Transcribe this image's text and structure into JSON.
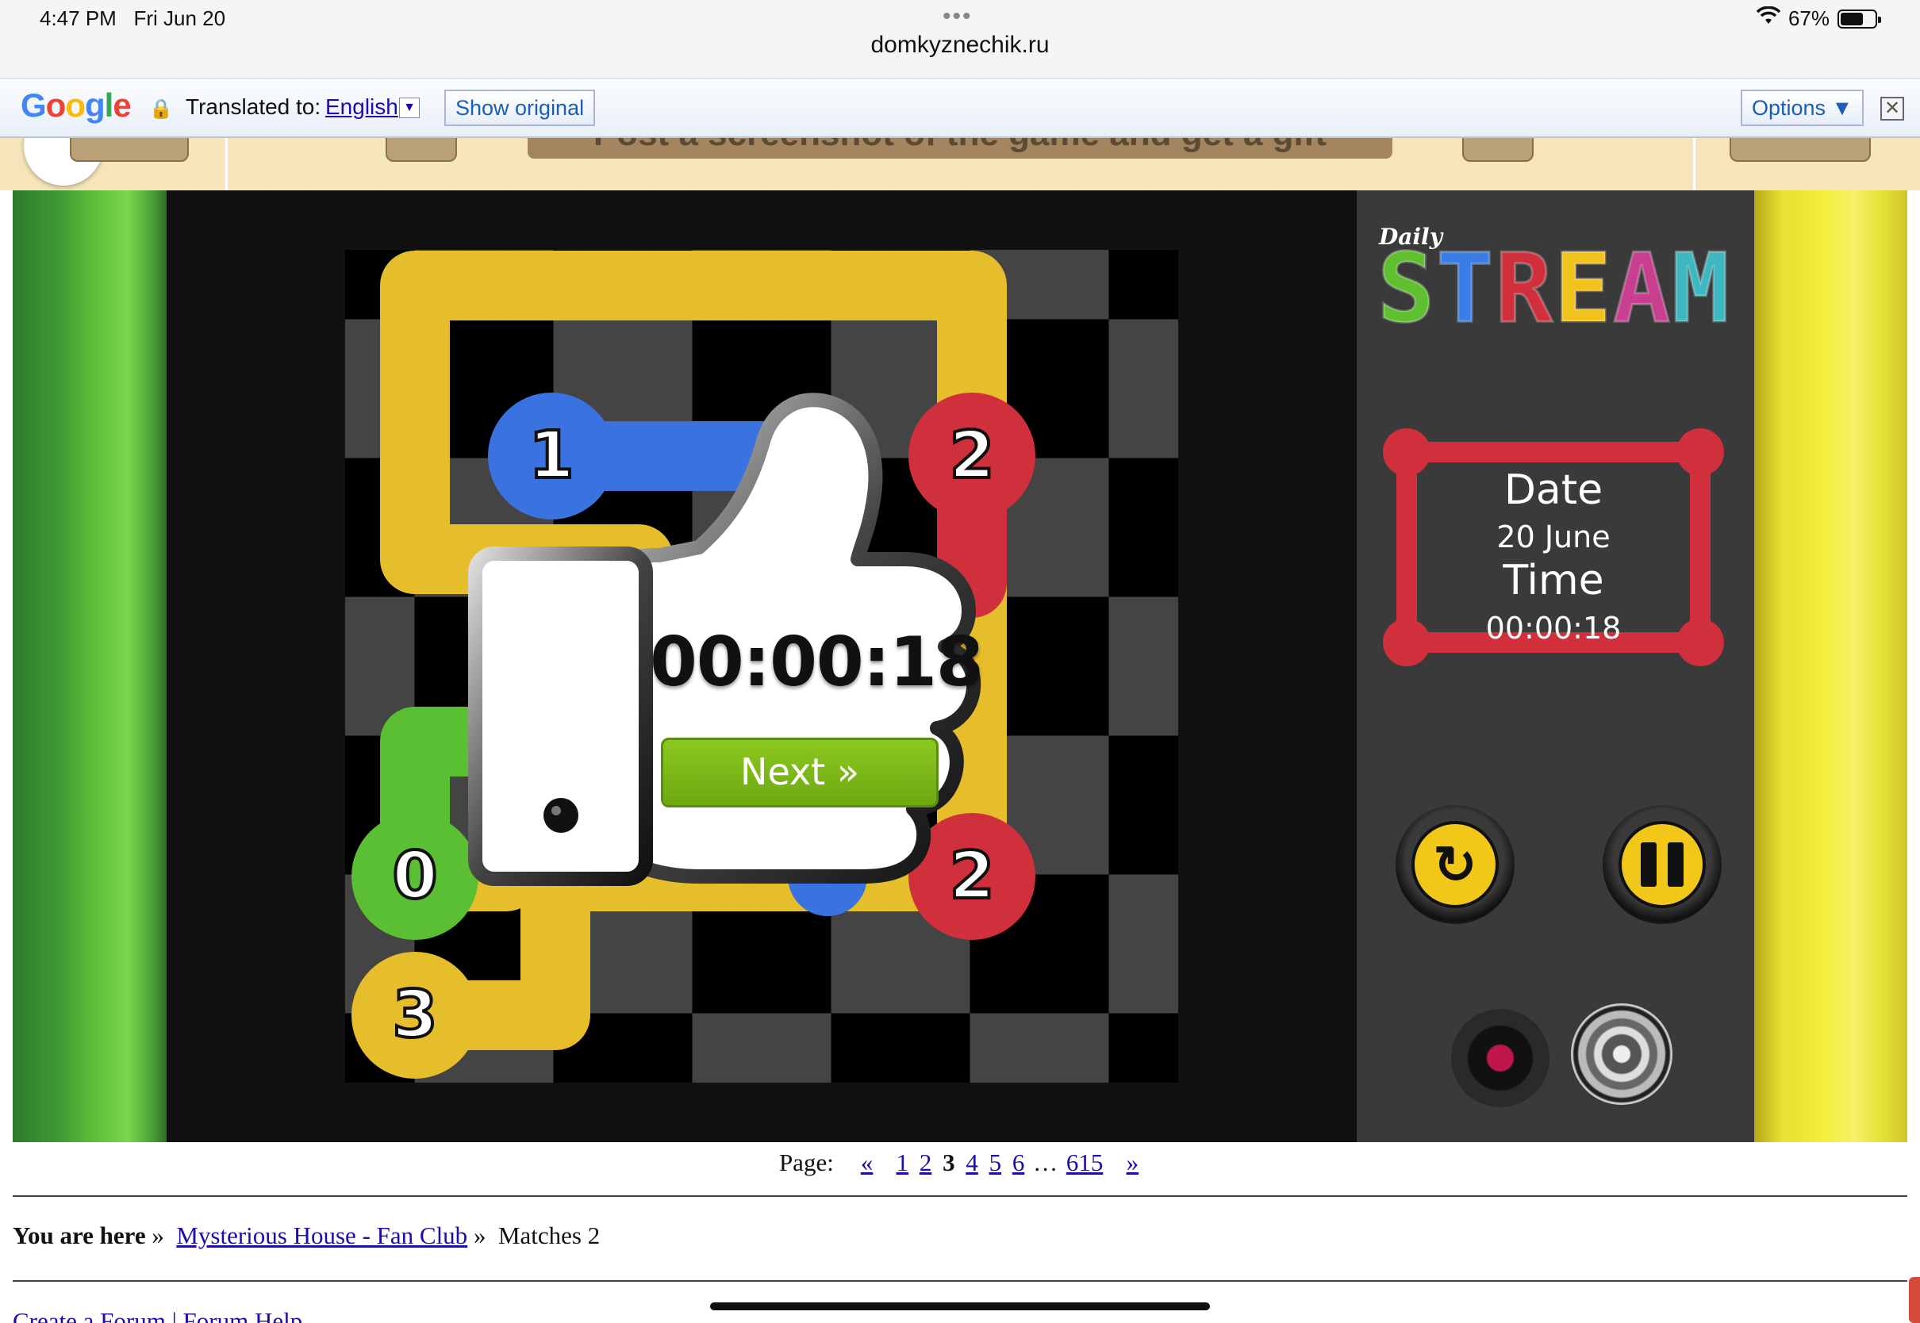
{
  "status_bar": {
    "time": "4:47 PM",
    "date": "Fri Jun 20",
    "url": "domkyznechik.ru",
    "battery": "67%"
  },
  "translate_bar": {
    "logo_letters": [
      {
        "ch": "G",
        "color": "#4285f4"
      },
      {
        "ch": "o",
        "color": "#ea4335"
      },
      {
        "ch": "o",
        "color": "#fbbc05"
      },
      {
        "ch": "g",
        "color": "#4285f4"
      },
      {
        "ch": "l",
        "color": "#34a853"
      },
      {
        "ch": "e",
        "color": "#ea4335"
      }
    ],
    "label": "Translated to:",
    "language": "English",
    "show_original": "Show original",
    "options": "Options ▼",
    "close": "✕"
  },
  "banner": {
    "text": "Post a screenshot of the game and get a gift"
  },
  "game": {
    "logo_small": "Daily",
    "logo_letters": [
      {
        "ch": "S",
        "color": "#5fbf2f"
      },
      {
        "ch": "T",
        "color": "#3a7de6"
      },
      {
        "ch": "R",
        "color": "#d0303c"
      },
      {
        "ch": "E",
        "color": "#f0c21b"
      },
      {
        "ch": "A",
        "color": "#c93f8f"
      },
      {
        "ch": "M",
        "color": "#3fb7c0"
      }
    ],
    "date_label": "Date",
    "date_value": "20 June",
    "time_label": "Time",
    "time_value": "00:00:18",
    "overlay_time": "00:00:18",
    "next_label": "Next »",
    "numbers": [
      "1",
      "2",
      "0",
      "2",
      "3"
    ]
  },
  "pager": {
    "label": "Page:",
    "prev": "«",
    "pages": [
      "1",
      "2"
    ],
    "current": "3",
    "more_pages": [
      "4",
      "5",
      "6"
    ],
    "ellipsis": "…",
    "last": "615",
    "next": "»"
  },
  "breadcrumb": {
    "prefix": "You are here",
    "sep": "»",
    "link": "Mysterious House - Fan Club",
    "current": "Matches 2"
  },
  "footer_links": "Create a Forum | Forum Help"
}
